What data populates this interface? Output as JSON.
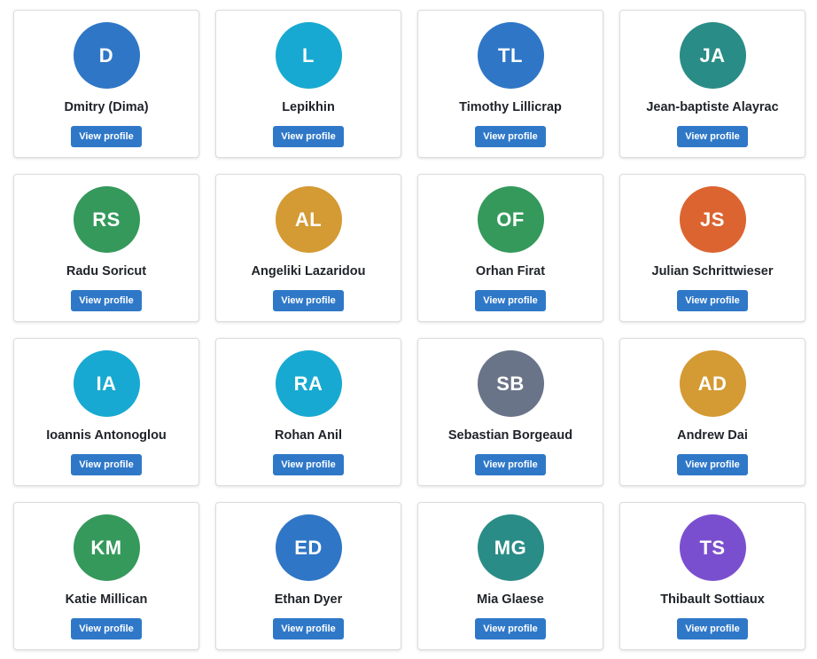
{
  "people": [
    {
      "initials": "D",
      "name": "Dmitry (Dima)",
      "button_label": "View profile",
      "avatar_color": "#2f76c6"
    },
    {
      "initials": "L",
      "name": "Lepikhin",
      "button_label": "View profile",
      "avatar_color": "#17a9d1"
    },
    {
      "initials": "TL",
      "name": "Timothy Lillicrap",
      "button_label": "View profile",
      "avatar_color": "#2f76c6"
    },
    {
      "initials": "JA",
      "name": "Jean-baptiste Alayrac",
      "button_label": "View profile",
      "avatar_color": "#2a8c86"
    },
    {
      "initials": "RS",
      "name": "Radu Soricut",
      "button_label": "View profile",
      "avatar_color": "#35995c"
    },
    {
      "initials": "AL",
      "name": "Angeliki Lazaridou",
      "button_label": "View profile",
      "avatar_color": "#d49a33"
    },
    {
      "initials": "OF",
      "name": "Orhan Firat",
      "button_label": "View profile",
      "avatar_color": "#35995c"
    },
    {
      "initials": "JS",
      "name": "Julian Schrittwieser",
      "button_label": "View profile",
      "avatar_color": "#dc6430"
    },
    {
      "initials": "IA",
      "name": "Ioannis Antonoglou",
      "button_label": "View profile",
      "avatar_color": "#17a9d1"
    },
    {
      "initials": "RA",
      "name": "Rohan Anil",
      "button_label": "View profile",
      "avatar_color": "#17a9d1"
    },
    {
      "initials": "SB",
      "name": "Sebastian Borgeaud",
      "button_label": "View profile",
      "avatar_color": "#6a7488"
    },
    {
      "initials": "AD",
      "name": "Andrew Dai",
      "button_label": "View profile",
      "avatar_color": "#d49a33"
    },
    {
      "initials": "KM",
      "name": "Katie Millican",
      "button_label": "View profile",
      "avatar_color": "#35995c"
    },
    {
      "initials": "ED",
      "name": "Ethan Dyer",
      "button_label": "View profile",
      "avatar_color": "#2f76c6"
    },
    {
      "initials": "MG",
      "name": "Mia Glaese",
      "button_label": "View profile",
      "avatar_color": "#2a8c86"
    },
    {
      "initials": "TS",
      "name": "Thibault Sottiaux",
      "button_label": "View profile",
      "avatar_color": "#7a4fcf"
    }
  ]
}
